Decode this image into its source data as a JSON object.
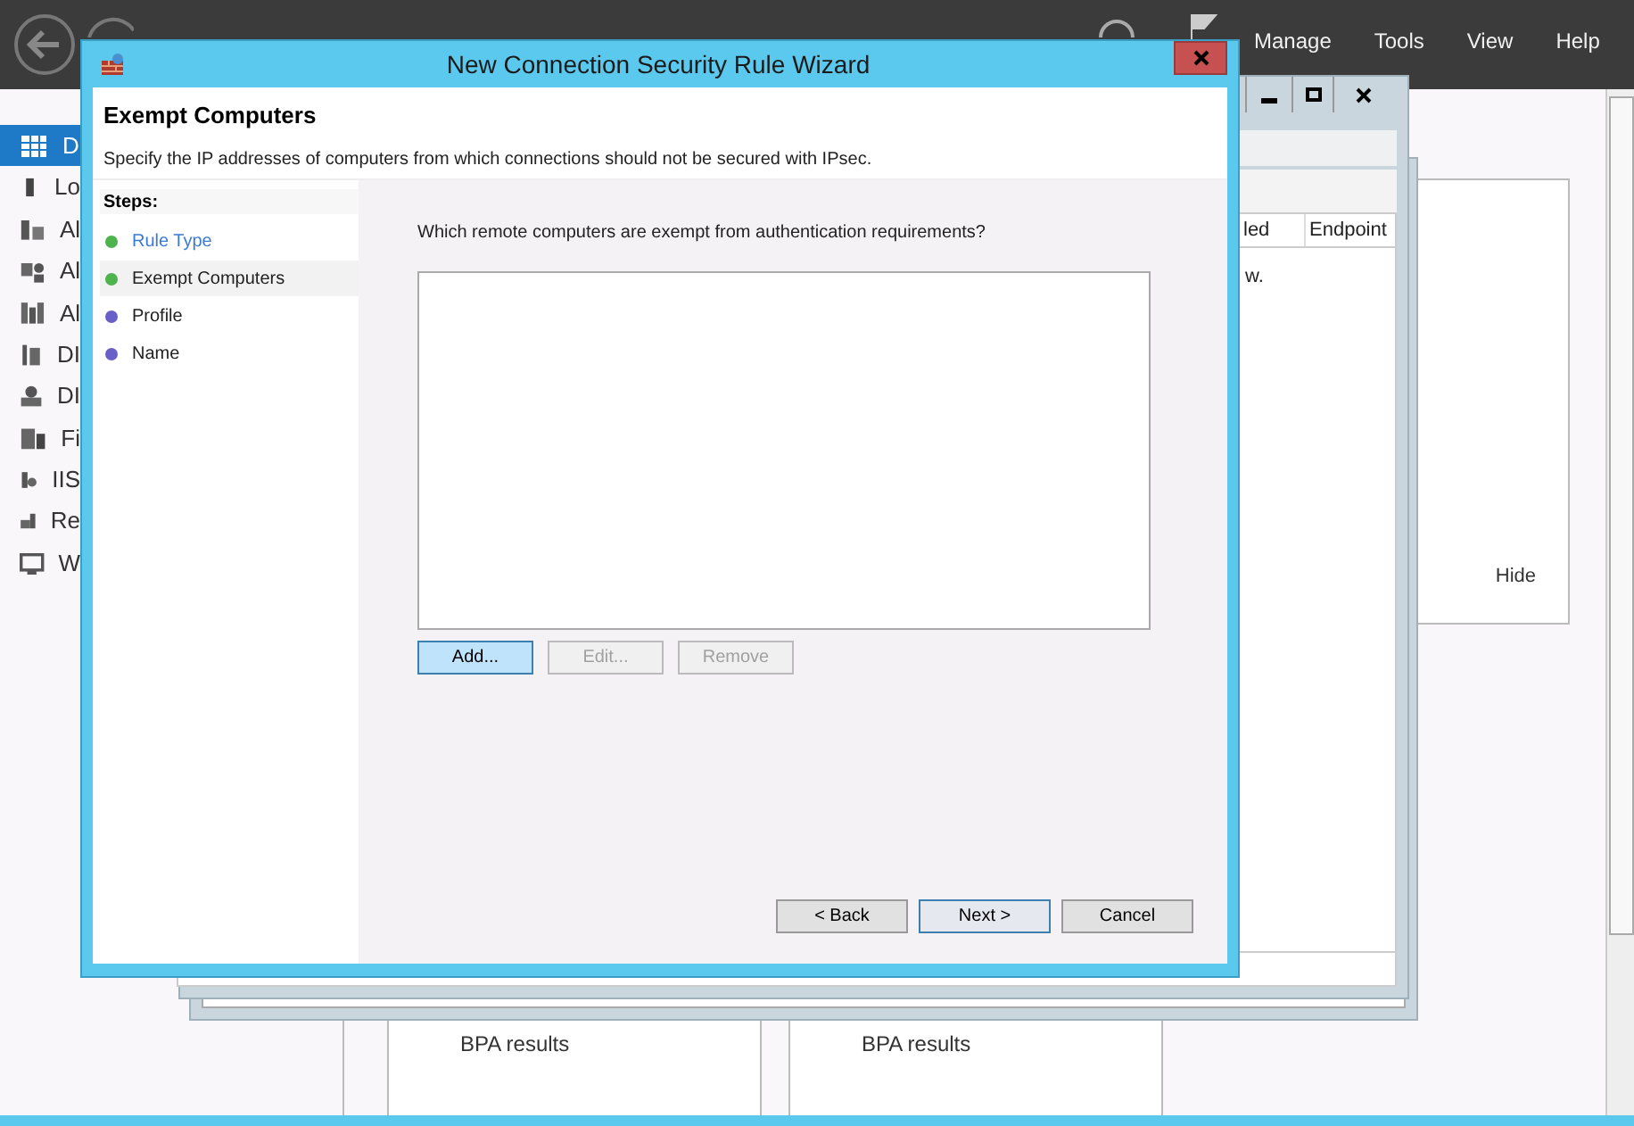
{
  "server_manager": {
    "menu": [
      "Manage",
      "Tools",
      "View",
      "Help"
    ],
    "sidebar": {
      "items": [
        {
          "label": "D",
          "selected": true
        },
        {
          "label": "Lo",
          "selected": false
        },
        {
          "label": "Al",
          "selected": false
        },
        {
          "label": "Al",
          "selected": false
        },
        {
          "label": "Al",
          "selected": false
        },
        {
          "label": "DI",
          "selected": false
        },
        {
          "label": "DI",
          "selected": false
        },
        {
          "label": "Fi",
          "selected": false
        },
        {
          "label": "IIS",
          "selected": false
        },
        {
          "label": "Re",
          "selected": false
        },
        {
          "label": "W",
          "selected": false
        }
      ]
    },
    "hide_link": "Hide",
    "tiles": [
      {
        "label": "BPA results"
      },
      {
        "label": "BPA results"
      }
    ]
  },
  "background_window": {
    "columns": [
      "led",
      "Endpoint"
    ],
    "text": "w."
  },
  "wizard": {
    "title": "New Connection Security Rule Wizard",
    "heading": "Exempt Computers",
    "description": "Specify the IP addresses of computers from which connections should not be secured with IPsec.",
    "steps_label": "Steps:",
    "steps": [
      {
        "label": "Rule Type",
        "selected": false,
        "completed": true
      },
      {
        "label": "Exempt Computers",
        "selected": true,
        "completed": true
      },
      {
        "label": "Profile",
        "selected": false,
        "completed": false
      },
      {
        "label": "Name",
        "selected": false,
        "completed": false
      }
    ],
    "question": "Which remote computers are exempt from authentication requirements?",
    "list_buttons": [
      {
        "label": "Add...",
        "disabled": false,
        "focused": true
      },
      {
        "label": "Edit...",
        "disabled": true,
        "focused": false
      },
      {
        "label": "Remove",
        "disabled": true,
        "focused": false
      }
    ],
    "nav_buttons": [
      {
        "label": "< Back",
        "default": false
      },
      {
        "label": "Next >",
        "default": true
      },
      {
        "label": "Cancel",
        "default": false
      }
    ]
  }
}
